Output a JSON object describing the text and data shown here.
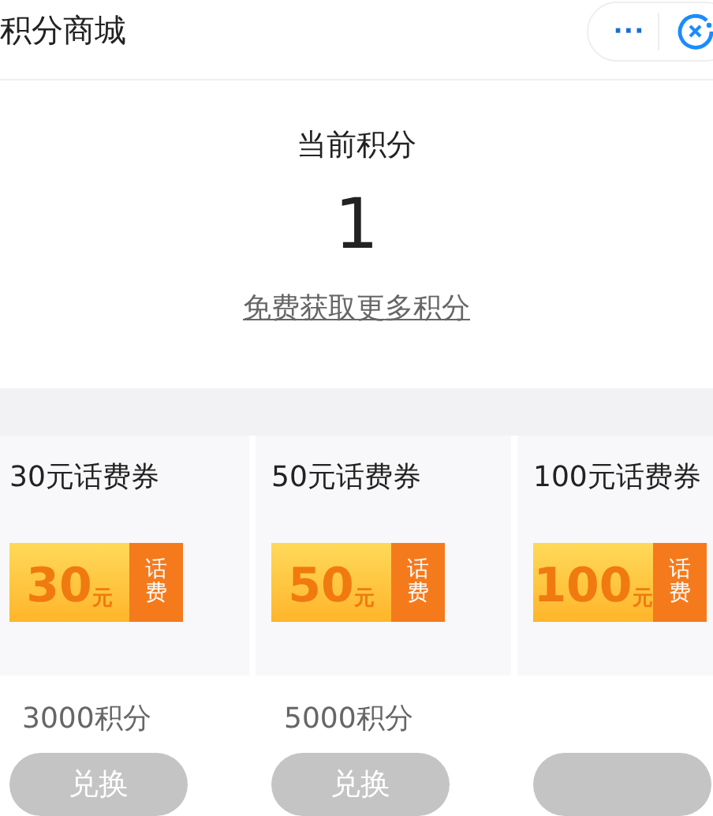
{
  "header": {
    "title": "积分商城",
    "more": "···"
  },
  "points": {
    "label": "当前积分",
    "value": "1",
    "link": "免费获取更多积分"
  },
  "cards": [
    {
      "title": "30元话费券",
      "amount": "30",
      "unit": "元",
      "tag": "话费",
      "price": "3000积分",
      "button": "兑换"
    },
    {
      "title": "50元话费券",
      "amount": "50",
      "unit": "元",
      "tag": "话费",
      "price": "5000积分",
      "button": "兑换"
    },
    {
      "title": "100元话费券",
      "amount": "100",
      "unit": "元",
      "tag": "话费"
    }
  ]
}
